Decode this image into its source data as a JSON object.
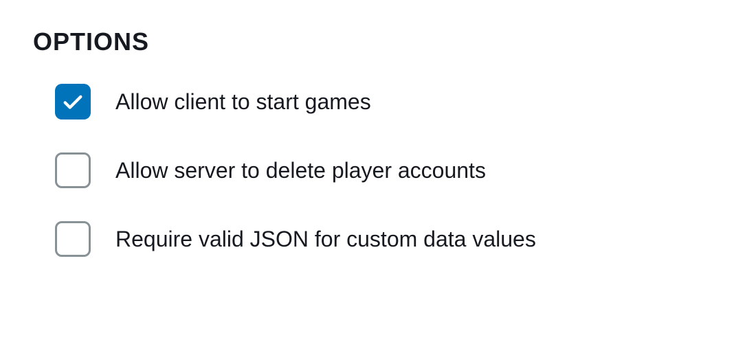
{
  "section": {
    "title": "OPTIONS"
  },
  "options": [
    {
      "label": "Allow client to start games",
      "checked": true
    },
    {
      "label": "Allow server to delete player accounts",
      "checked": false
    },
    {
      "label": "Require valid JSON for custom data values",
      "checked": false
    }
  ]
}
